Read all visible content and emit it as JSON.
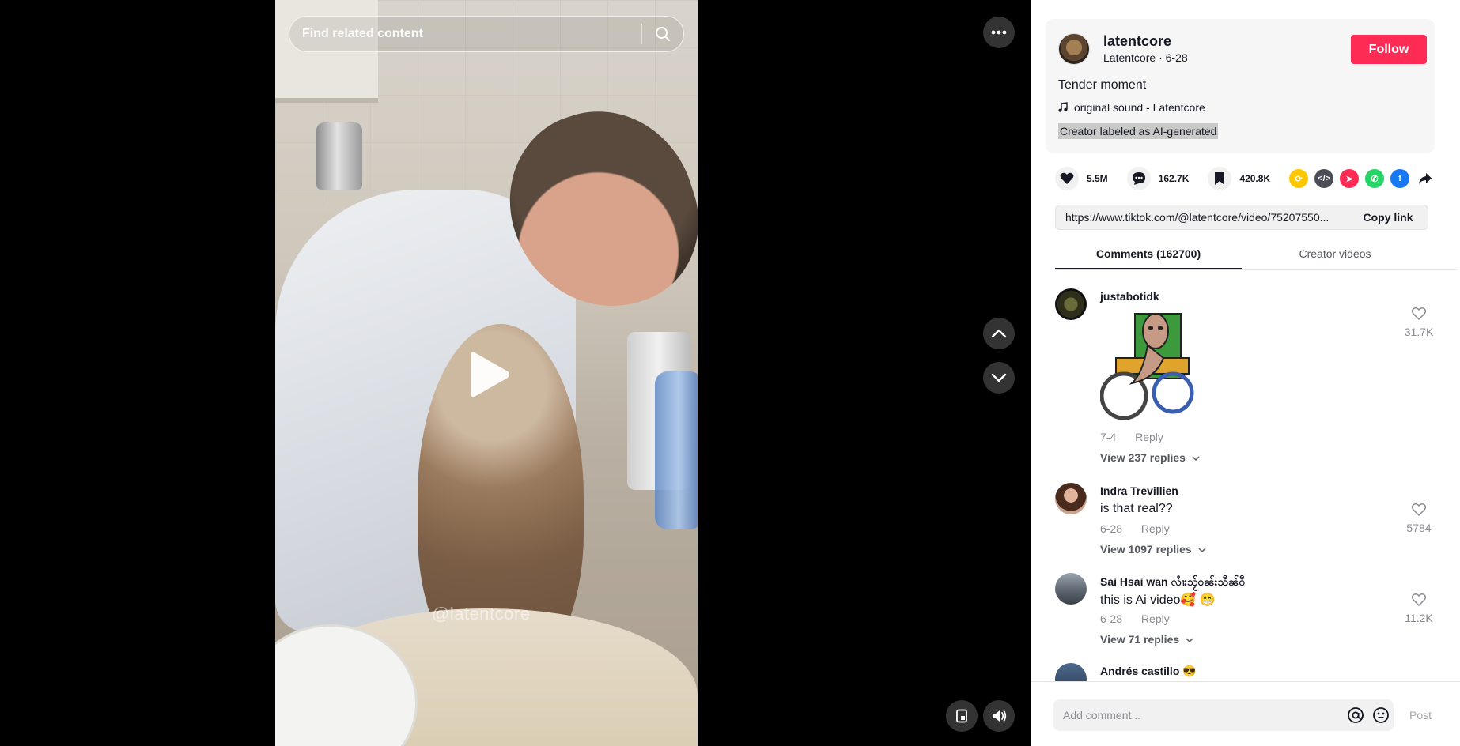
{
  "search": {
    "placeholder": "Find related content"
  },
  "video": {
    "watermark": "@latentcore"
  },
  "author": {
    "username": "latentcore",
    "display_name": "Latentcore",
    "date": "6-28",
    "follow_label": "Follow"
  },
  "post": {
    "description": "Tender moment",
    "sound": "original sound - Latentcore",
    "ai_label": "Creator labeled as AI-generated"
  },
  "stats": {
    "likes": "5.5M",
    "comments": "162.7K",
    "saves": "420.8K"
  },
  "share": {
    "link": "https://www.tiktok.com/@latentcore/video/75207550...",
    "copy_label": "Copy link"
  },
  "tabs": [
    {
      "label": "Comments (162700)",
      "active": true
    },
    {
      "label": "Creator videos",
      "active": false
    }
  ],
  "comments": [
    {
      "user": "justabotidk",
      "text": "",
      "date": "7-4",
      "reply": "Reply",
      "replies": "View 237 replies",
      "likes": "31.7K"
    },
    {
      "user": "Indra Trevillien",
      "text": "is that real??",
      "date": "6-28",
      "reply": "Reply",
      "replies": "View 1097 replies",
      "likes": "5784"
    },
    {
      "user": "Sai Hsai wan လၢႆးသႂ်ဝၼ်းသီၼ်ဝီ",
      "text": "this is Ai video🥰 😁",
      "date": "6-28",
      "reply": "Reply",
      "replies": "View 71 replies",
      "likes": "11.2K"
    },
    {
      "user": "Andrés castillo 😎",
      "text": "",
      "date": "",
      "reply": "",
      "replies": "",
      "likes": ""
    }
  ],
  "composer": {
    "placeholder": "Add comment...",
    "post_label": "Post"
  },
  "colors": {
    "accent": "#fe2c55",
    "text": "#161823",
    "muted": "#8a8b91"
  }
}
